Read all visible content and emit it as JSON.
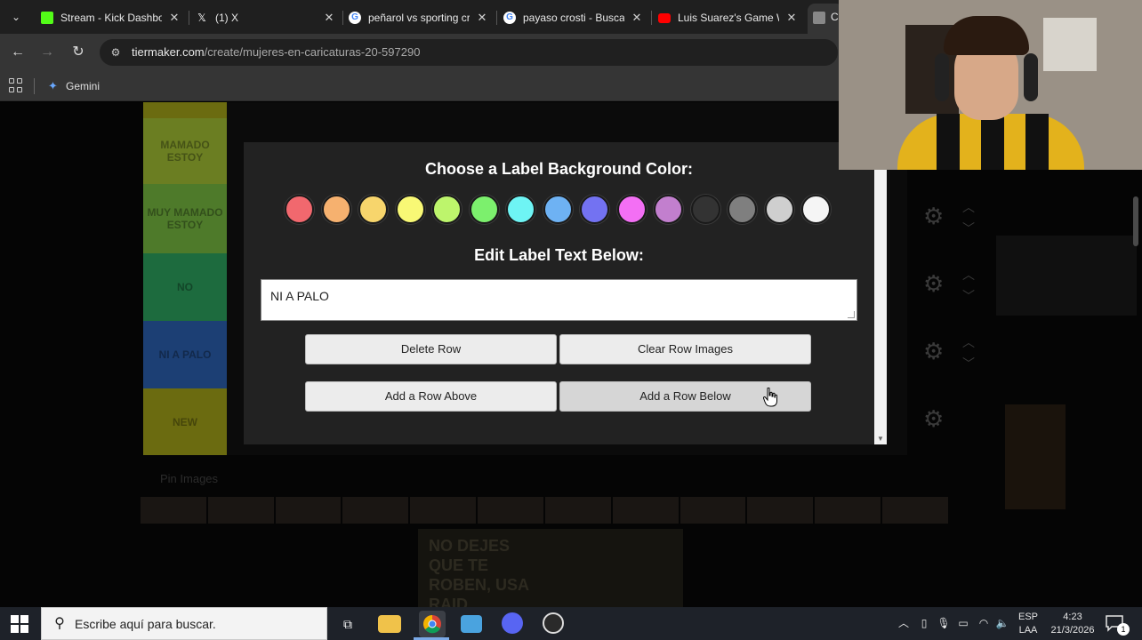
{
  "browser": {
    "tabs": [
      {
        "title": "Stream - Kick Dashboard",
        "favicon_color": "#53fc18"
      },
      {
        "title": "(1) X",
        "favicon_color": "#000000"
      },
      {
        "title": "peñarol vs sporting cristal",
        "favicon_color": "#4285f4"
      },
      {
        "title": "payaso crosti - Buscar",
        "favicon_color": "#4285f4"
      },
      {
        "title": "Luis Suarez's Game Winner",
        "favicon_color": "#ff0000"
      },
      {
        "title": "C",
        "favicon_color": "#888888"
      }
    ],
    "url_domain": "tiermaker.com",
    "url_path": "/create/mujeres-en-caricaturas-20-597290",
    "bookmarks": [
      {
        "label": "Gemini"
      }
    ]
  },
  "tiers": [
    {
      "label": "MAMADO ESTOY",
      "color": "#6b7e22"
    },
    {
      "label": "MUY MAMADO ESTOY",
      "color": "#4e7a2a"
    },
    {
      "label": "NO",
      "color": "#1d6b3e"
    },
    {
      "label": "NI A PALO",
      "color": "#1c3f74"
    },
    {
      "label": "NEW",
      "color": "#6b6b10"
    }
  ],
  "pool": {
    "label": "Pin Images"
  },
  "ad": {
    "text": "NO DEJES QUE TE ROBEN, USA RAID"
  },
  "modal": {
    "color_heading": "Choose a Label Background Color:",
    "colors": [
      "#f1686e",
      "#f6b16f",
      "#f7d56c",
      "#f8f875",
      "#bdf56c",
      "#7cf06d",
      "#6ef4f4",
      "#6eb2f3",
      "#7372f2",
      "#f36ff4",
      "#c27fce",
      "#333333",
      "#7f7f7f",
      "#cfcfcf",
      "#f5f5f5"
    ],
    "text_heading": "Edit Label Text Below:",
    "label_value": "NI A PALO",
    "buttons": {
      "delete_row": "Delete Row",
      "clear_row_images": "Clear Row Images",
      "add_row_above": "Add a Row Above",
      "add_row_below": "Add a Row Below"
    }
  },
  "taskbar": {
    "search_placeholder": "Escribe aquí para buscar.",
    "language_line1": "ESP",
    "language_line2": "LAA",
    "time": "4:23",
    "date": "21/3/2026",
    "notification_count": "1"
  }
}
